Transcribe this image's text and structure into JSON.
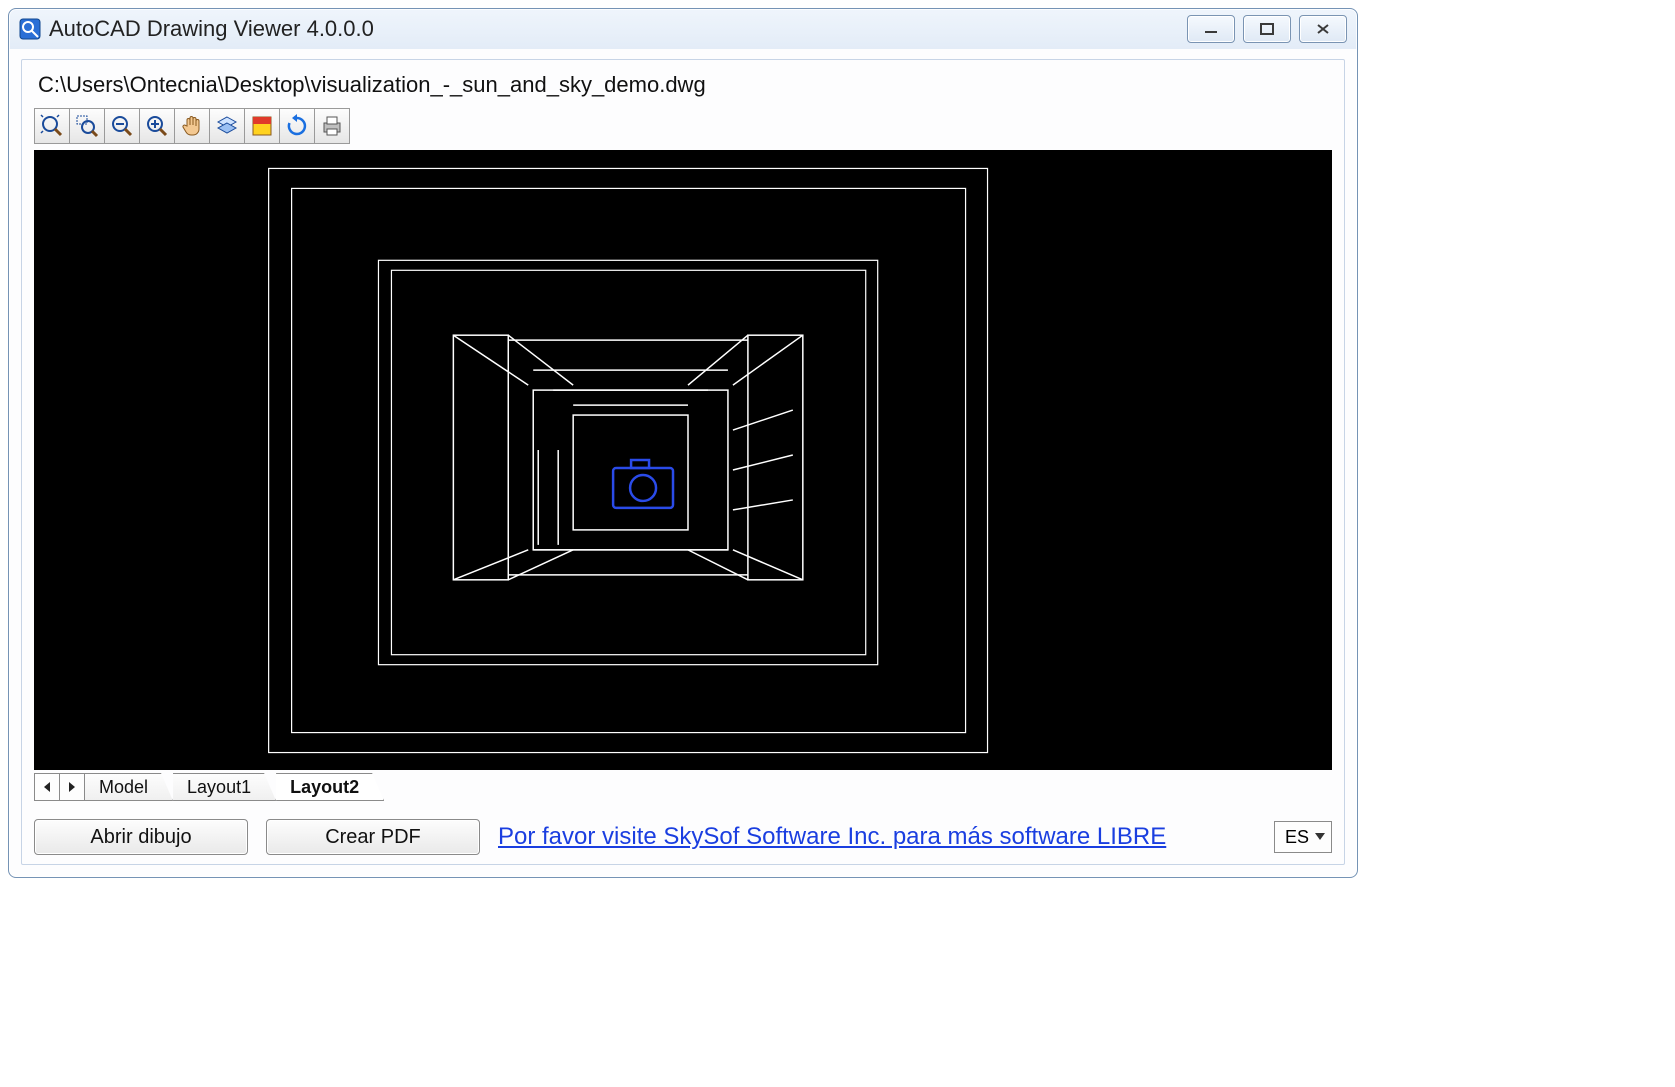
{
  "window": {
    "title": "AutoCAD Drawing Viewer 4.0.0.0"
  },
  "file_path": "C:\\Users\\Ontecnia\\Desktop\\visualization_-_sun_and_sky_demo.dwg",
  "toolbar": {
    "buttons": [
      {
        "name": "zoom-extents",
        "kind": "magnifier-arrows"
      },
      {
        "name": "zoom-window",
        "kind": "magnifier-plus"
      },
      {
        "name": "zoom-out",
        "kind": "magnifier-minus"
      },
      {
        "name": "zoom-in",
        "kind": "magnifier-plus-bold"
      },
      {
        "name": "pan",
        "kind": "hand"
      },
      {
        "name": "layers",
        "kind": "layers"
      },
      {
        "name": "toggle-colors",
        "kind": "color-box"
      },
      {
        "name": "regen",
        "kind": "refresh"
      },
      {
        "name": "print",
        "kind": "printer"
      }
    ]
  },
  "tabs": {
    "items": [
      {
        "label": "Model"
      },
      {
        "label": "Layout1"
      },
      {
        "label": "Layout2"
      }
    ],
    "active_index": 2
  },
  "bottom": {
    "open_label": "Abrir dibujo",
    "pdf_label": "Crear PDF",
    "link_text": "Por favor visite SkySof Software Inc. para más software LIBRE",
    "language": "ES"
  },
  "drawing": {
    "colors": {
      "wire": "#ffffff",
      "accent": "#2a4be8",
      "bg": "#000000"
    },
    "camera_icon": true
  }
}
